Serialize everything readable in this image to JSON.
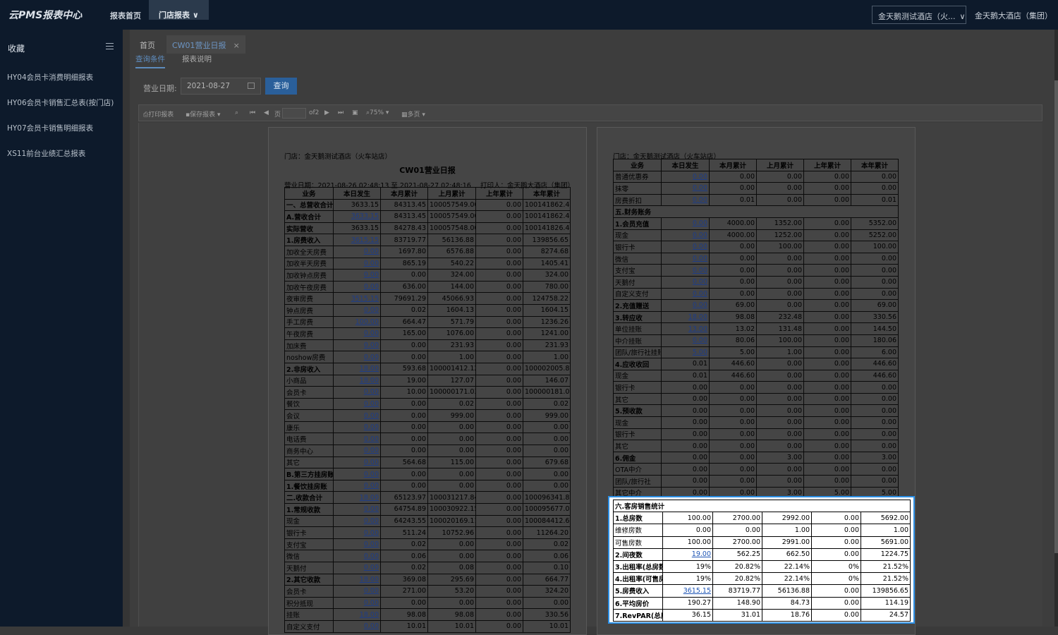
{
  "app_title": "云PMS报表中心",
  "nav": {
    "home": "报表首页",
    "store": "门店报表"
  },
  "hotel_select": "金天鹅测试酒店（火...",
  "user_name": "金天鹅大酒店（集团）",
  "sidebar": {
    "title": "收藏",
    "items": [
      "HY04会员卡消费明细报表",
      "HY06会员卡销售汇总表(按门店)",
      "HY07会员卡销售明细报表",
      "XS11前台业绩汇总报表"
    ]
  },
  "tabs": {
    "home": "首页",
    "current": "CW01营业日报",
    "close": "×"
  },
  "subtabs": {
    "query": "查询条件",
    "desc": "报表说明"
  },
  "query": {
    "date_label": "营业日期:",
    "date_value": "2021-08-27",
    "button": "查询"
  },
  "toolbar": {
    "print": "打印报表",
    "save": "保存报表",
    "page_of": "of2",
    "zoom": "75%",
    "multi": "多页"
  },
  "report": {
    "store": "门店：金天鹅测试酒店（火车站店）",
    "title": "CW01营业日报",
    "bizdate": "营业日期：2021-08-26 02:48:13 至 2021-08-27 02:48:16",
    "printer": "打印人：金天鹅大酒店（集团）",
    "headers": [
      "业务",
      "本日发生",
      "本月累计",
      "上月累计",
      "上年累计",
      "本年累计"
    ],
    "page1_rows": [
      [
        "一、总营收合计",
        "3633.15",
        "84313.45",
        "100057549.00",
        "0.00",
        "100141862.45",
        1,
        0
      ],
      [
        "A.营收合计",
        "3633.15",
        "84313.45",
        "100057549.00",
        "0.00",
        "100141862.45",
        1,
        1
      ],
      [
        "实际营收",
        "3633.15",
        "84278.43",
        "100057548.00",
        "0.00",
        "100141826.43",
        1,
        0
      ],
      [
        "1.房费收入",
        "3615.15",
        "83719.77",
        "56136.88",
        "0.00",
        "139856.65",
        1,
        1
      ],
      [
        "加收全天房费",
        "0.00",
        "1697.80",
        "6576.88",
        "0.00",
        "8274.68",
        0,
        1
      ],
      [
        "加收半天房费",
        "0.00",
        "865.19",
        "540.22",
        "0.00",
        "1405.41",
        0,
        1
      ],
      [
        "加收钟点房费",
        "0.00",
        "0.00",
        "324.00",
        "0.00",
        "324.00",
        0,
        1
      ],
      [
        "加收午夜房费",
        "0.00",
        "636.00",
        "144.00",
        "0.00",
        "780.00",
        0,
        1
      ],
      [
        "夜审房费",
        "3515.15",
        "79691.29",
        "45066.93",
        "0.00",
        "124758.22",
        0,
        1
      ],
      [
        "钟点房费",
        "0.00",
        "0.02",
        "1604.13",
        "0.00",
        "1604.15",
        0,
        1
      ],
      [
        "手工房费",
        "100.00",
        "664.47",
        "571.79",
        "0.00",
        "1236.26",
        0,
        1
      ],
      [
        "午夜房费",
        "0.00",
        "165.00",
        "1076.00",
        "0.00",
        "1241.00",
        0,
        1
      ],
      [
        "加床费",
        "0.00",
        "0.00",
        "231.93",
        "0.00",
        "231.93",
        0,
        1
      ],
      [
        "noshow房费",
        "0.00",
        "0.00",
        "1.00",
        "0.00",
        "1.00",
        0,
        1
      ],
      [
        "2.非房收入",
        "18.00",
        "593.68",
        "100001412.12",
        "0.00",
        "100002005.80",
        1,
        1
      ],
      [
        "小商品",
        "18.00",
        "19.00",
        "127.07",
        "0.00",
        "146.07",
        0,
        1
      ],
      [
        "会员卡",
        "0.00",
        "10.00",
        "100000171.03",
        "0.00",
        "100000181.03",
        0,
        1
      ],
      [
        "餐饮",
        "0.00",
        "0.00",
        "0.02",
        "0.00",
        "0.02",
        0,
        1
      ],
      [
        "会议",
        "0.00",
        "0.00",
        "999.00",
        "0.00",
        "999.00",
        0,
        1
      ],
      [
        "康乐",
        "0.00",
        "0.00",
        "0.00",
        "0.00",
        "0.00",
        0,
        1
      ],
      [
        "电话费",
        "0.00",
        "0.00",
        "0.00",
        "0.00",
        "0.00",
        0,
        1
      ],
      [
        "商务中心",
        "0.00",
        "0.00",
        "0.00",
        "0.00",
        "0.00",
        0,
        1
      ],
      [
        "其它",
        "0.00",
        "564.68",
        "115.00",
        "0.00",
        "679.68",
        0,
        1
      ],
      [
        "B.第三方挂房账",
        "0.00",
        "0.00",
        "0.00",
        "0.00",
        "0.00",
        1,
        1
      ],
      [
        "1.餐饮挂房账",
        "0.00",
        "0.00",
        "0.00",
        "0.00",
        "0.00",
        1,
        1
      ],
      [
        "二.收款合计",
        "18.00",
        "65123.97",
        "100031217.84",
        "0.00",
        "100096341.81",
        1,
        1
      ],
      [
        "1.常规收款",
        "0.00",
        "64754.89",
        "100030922.15",
        "0.00",
        "100095677.04",
        1,
        1
      ],
      [
        "现金",
        "0.00",
        "64243.55",
        "100020169.11",
        "0.00",
        "100084412.66",
        0,
        1
      ],
      [
        "银行卡",
        "0.00",
        "511.24",
        "10752.96",
        "0.00",
        "11264.20",
        0,
        1
      ],
      [
        "支付宝",
        "0.00",
        "0.02",
        "0.00",
        "0.00",
        "0.02",
        0,
        1
      ],
      [
        "微信",
        "0.00",
        "0.06",
        "0.00",
        "0.00",
        "0.06",
        0,
        1
      ],
      [
        "天鹅付",
        "0.00",
        "0.02",
        "0.08",
        "0.00",
        "0.10",
        0,
        1
      ],
      [
        "2.其它收款",
        "18.00",
        "369.08",
        "295.69",
        "0.00",
        "664.77",
        1,
        1
      ],
      [
        "会员卡",
        "0.00",
        "271.00",
        "53.20",
        "0.00",
        "324.20",
        0,
        1
      ],
      [
        "积分抵现",
        "0.00",
        "0.00",
        "0.00",
        "0.00",
        "0.00",
        0,
        1
      ],
      [
        "挂账",
        "18.00",
        "98.08",
        "98.08",
        "0.00",
        "330.56",
        0,
        1
      ],
      [
        "自定义支付",
        "0.00",
        "10.01",
        "10.01",
        "0.00",
        "10.01",
        0,
        1
      ]
    ],
    "page2_rows": [
      [
        "普通优惠券",
        "0.00",
        "0.00",
        "0.00",
        "0.00",
        "0.00",
        0,
        1
      ],
      [
        "抹零",
        "0.00",
        "0.00",
        "0.00",
        "0.00",
        "0.00",
        0,
        1
      ],
      [
        "房费折扣",
        "0.00",
        "0.01",
        "0.00",
        "0.00",
        "0.01",
        0,
        1
      ],
      [
        "五.财务账务",
        "",
        "",
        "",
        "",
        "",
        2,
        0
      ],
      [
        "1.会员充值",
        "0.00",
        "4000.00",
        "1352.00",
        "0.00",
        "5352.00",
        1,
        1
      ],
      [
        "现金",
        "0.00",
        "4000.00",
        "1252.00",
        "0.00",
        "5252.00",
        0,
        1
      ],
      [
        "银行卡",
        "0.00",
        "0.00",
        "100.00",
        "0.00",
        "100.00",
        0,
        1
      ],
      [
        "微信",
        "0.00",
        "0.00",
        "0.00",
        "0.00",
        "0.00",
        0,
        1
      ],
      [
        "支付宝",
        "0.00",
        "0.00",
        "0.00",
        "0.00",
        "0.00",
        0,
        1
      ],
      [
        "天鹅付",
        "0.00",
        "0.00",
        "0.00",
        "0.00",
        "0.00",
        0,
        1
      ],
      [
        "自定义支付",
        "0.00",
        "0.00",
        "0.00",
        "0.00",
        "0.00",
        0,
        1
      ],
      [
        "2.充值赠送",
        "0.00",
        "69.00",
        "0.00",
        "0.00",
        "69.00",
        1,
        1
      ],
      [
        "3.转应收",
        "18.00",
        "98.08",
        "232.48",
        "0.00",
        "330.56",
        1,
        1
      ],
      [
        "单位挂账",
        "13.00",
        "13.02",
        "131.48",
        "0.00",
        "144.50",
        0,
        1
      ],
      [
        "中介挂账",
        "0.00",
        "80.06",
        "100.00",
        "0.00",
        "180.06",
        0,
        1
      ],
      [
        "团队/旅行社挂账",
        "5.00",
        "5.00",
        "1.00",
        "0.00",
        "6.00",
        0,
        1
      ],
      [
        "4.应收收回",
        "0.01",
        "446.60",
        "0.00",
        "0.00",
        "446.60",
        1,
        0
      ],
      [
        "现金",
        "0.01",
        "446.60",
        "0.00",
        "0.00",
        "446.60",
        0,
        0
      ],
      [
        "银行卡",
        "0.00",
        "0.00",
        "0.00",
        "0.00",
        "0.00",
        0,
        0
      ],
      [
        "其它",
        "0.00",
        "0.00",
        "0.00",
        "0.00",
        "0.00",
        0,
        0
      ],
      [
        "5.预收款",
        "0.00",
        "0.00",
        "0.00",
        "0.00",
        "0.00",
        1,
        0
      ],
      [
        "现金",
        "0.00",
        "0.00",
        "0.00",
        "0.00",
        "0.00",
        0,
        0
      ],
      [
        "银行卡",
        "0.00",
        "0.00",
        "0.00",
        "0.00",
        "0.00",
        0,
        0
      ],
      [
        "其它",
        "0.00",
        "0.00",
        "0.00",
        "0.00",
        "0.00",
        0,
        0
      ],
      [
        "6.佣金",
        "0.00",
        "0.00",
        "3.00",
        "0.00",
        "3.00",
        1,
        0
      ],
      [
        "OTA中介",
        "0.00",
        "0.00",
        "0.00",
        "0.00",
        "0.00",
        0,
        0
      ],
      [
        "团队/旅行社",
        "0.00",
        "0.00",
        "0.00",
        "0.00",
        "0.00",
        0,
        0
      ],
      [
        "其它中介",
        "0.00",
        "0.00",
        "3.00",
        "5.00",
        "5.00",
        0,
        0
      ]
    ],
    "section6_title": "六.客房销售统计",
    "section6_rows": [
      [
        "1.总房数",
        "100.00",
        "2700.00",
        "2992.00",
        "0.00",
        "5692.00",
        1,
        0
      ],
      [
        "维修房数",
        "0.00",
        "0.00",
        "1.00",
        "0.00",
        "1.00",
        0,
        0
      ],
      [
        "可售房数",
        "100.00",
        "2700.00",
        "2991.00",
        "0.00",
        "5691.00",
        0,
        0
      ],
      [
        "2.间夜数",
        "19.00",
        "562.25",
        "662.50",
        "0.00",
        "1224.75",
        1,
        1
      ],
      [
        "3.出租率(总房数",
        "19%",
        "20.82%",
        "22.14%",
        "0%",
        "21.52%",
        1,
        0
      ],
      [
        "4.出租率(可售房",
        "19%",
        "20.82%",
        "22.14%",
        "0%",
        "21.52%",
        1,
        0
      ],
      [
        "5.房费收入",
        "3615.15",
        "83719.77",
        "56136.88",
        "0.00",
        "139856.65",
        1,
        1
      ],
      [
        "6.平均房价",
        "190.27",
        "148.90",
        "84.73",
        "0.00",
        "114.19",
        1,
        0
      ],
      [
        "7.RevPAR(总房",
        "36.15",
        "31.01",
        "18.76",
        "0.00",
        "24.57",
        1,
        0
      ]
    ]
  }
}
